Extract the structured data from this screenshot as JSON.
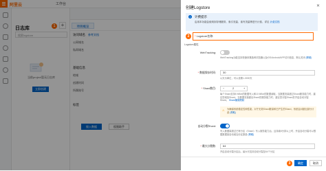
{
  "topbar": {
    "logo": "阿里云",
    "workbench": "工作台"
  },
  "sidebar": {
    "title": "日志库",
    "search_placeholder": "搜索logstore",
    "step_badge": "1",
    "empty_text": "当前project暂无日志库",
    "create_label": "立即创建",
    "add_icon": "plus-icon"
  },
  "main": {
    "tab_overview": "项目概览",
    "section_access": "访问域名",
    "row_public": "公网域名",
    "row_private": "私网域名",
    "link_ref": "参考文档",
    "section_basic": "基础信息",
    "row_region": "地域",
    "row_create_time": "创建时间",
    "row_account": "所属账号",
    "section_tags": "标签",
    "insert_label": "接入数据",
    "package_label": "权限助手"
  },
  "drawer": {
    "title": "创建Logstore",
    "billing_title": "计费提示",
    "billing_text": "启用本功能会使用到存储服务、索引流量、读写流量等进行计费，详见",
    "billing_link": "计费文档",
    "name_label": "Logstore名称:",
    "name_badge": "2",
    "name_under": "Logstore属性",
    "webtracking_label": "WebTracking:",
    "webtracking_on": false,
    "webtracking_desc": "WebTracking功能支持快速采集各种浏览器以及iOS/Android/APP访问信息，默认关闭",
    "webtracking_link": "(帮助)",
    "ttl_label": "数据保存时间:",
    "ttl_value": "30",
    "ttl_desc": "以天为单位，可以设置1-3000天",
    "shard_label": "Shard数目:",
    "shard_value": "2",
    "shard_desc": "每个Shard支持5 MB/s的数据写入和10 MB/s的数据读取。当数据流量超过Shard服务能力时，建议您增加Shard。当数据流量超出Shard的服务能力时，建议您分裂Shard并开启自动分裂Shard。",
    "shard_link": "Shard使用限制",
    "warn_text": "为确保系统稳定性和性能，对于无效Shard数量和已产生的Shard，系统会对超出部分计费",
    "warn_link": "(帮助)",
    "autosplit_label": "自动分裂Shard:",
    "autosplit_on": true,
    "autosplit_desc": "写入数据量超过已有分区（Shard）写入服务能力后，且持续5分钟以上时，开启自动分裂可以根据数据量自动增加分区数量",
    "autosplit_link": "(帮助)",
    "maxsplit_label": "最大分裂数:",
    "maxsplit_value": "64",
    "maxsplit_desc": "开启自动分裂分区后，最大可支持自动分裂至64个分区",
    "ok_label": "确定",
    "cancel_label": "取消",
    "ok_badge": "3",
    "colors": {
      "accent": "#0064c8",
      "highlight": "#ff6a00"
    }
  }
}
